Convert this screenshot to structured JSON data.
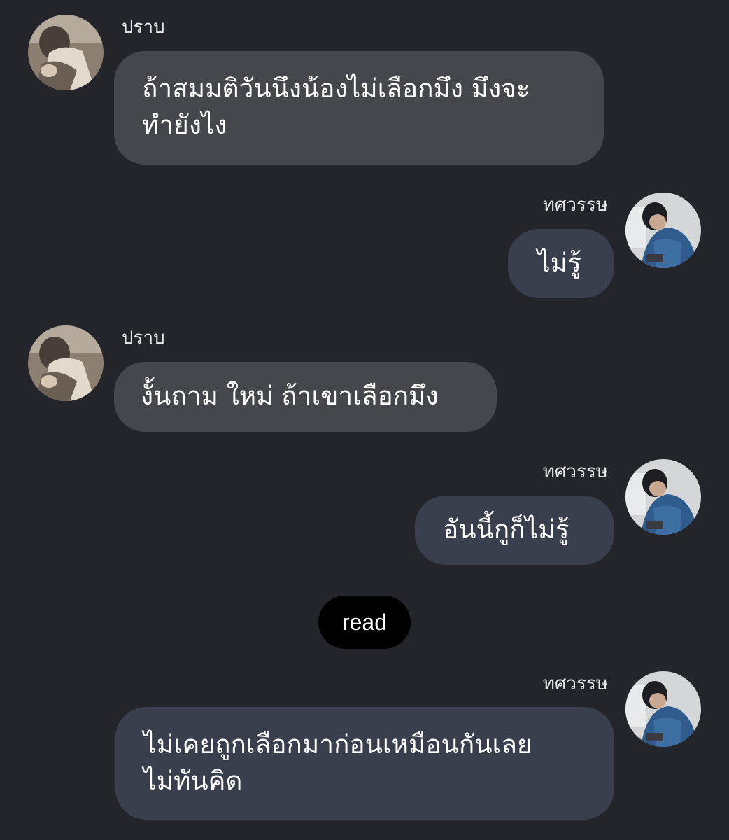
{
  "messages": [
    {
      "sender": "ปราบ",
      "avatar": "avatar-prab",
      "side": "left",
      "text_lines": [
        "ถ้าสมมติวันนึงน้องไม่เลือกมึง มึงจะ",
        "ทำยังไง"
      ]
    },
    {
      "sender": "ทศวรรษ",
      "avatar": "avatar-thotsawat",
      "side": "right",
      "text_lines": [
        "ไม่รู้"
      ]
    },
    {
      "sender": "ปราบ",
      "avatar": "avatar-prab",
      "side": "left",
      "text_lines": [
        "งั้นถาม ใหม่ ถ้าเขาเลือกมึง"
      ]
    },
    {
      "sender": "ทศวรรษ",
      "avatar": "avatar-thotsawat",
      "side": "right",
      "text_lines": [
        "อันนี้กูก็ไม่รู้"
      ]
    },
    {
      "sender": "ทศวรรษ",
      "avatar": "avatar-thotsawat",
      "side": "right",
      "text_lines": [
        "ไม่เคยถูกเลือกมาก่อนเหมือนกันเลย",
        "ไม่ทันคิด"
      ]
    }
  ],
  "read_marker": "read",
  "colors": {
    "background": "#24252b",
    "bubble_left": "#46474c",
    "bubble_right": "#3a3f4d",
    "read_pill": "#000000"
  }
}
